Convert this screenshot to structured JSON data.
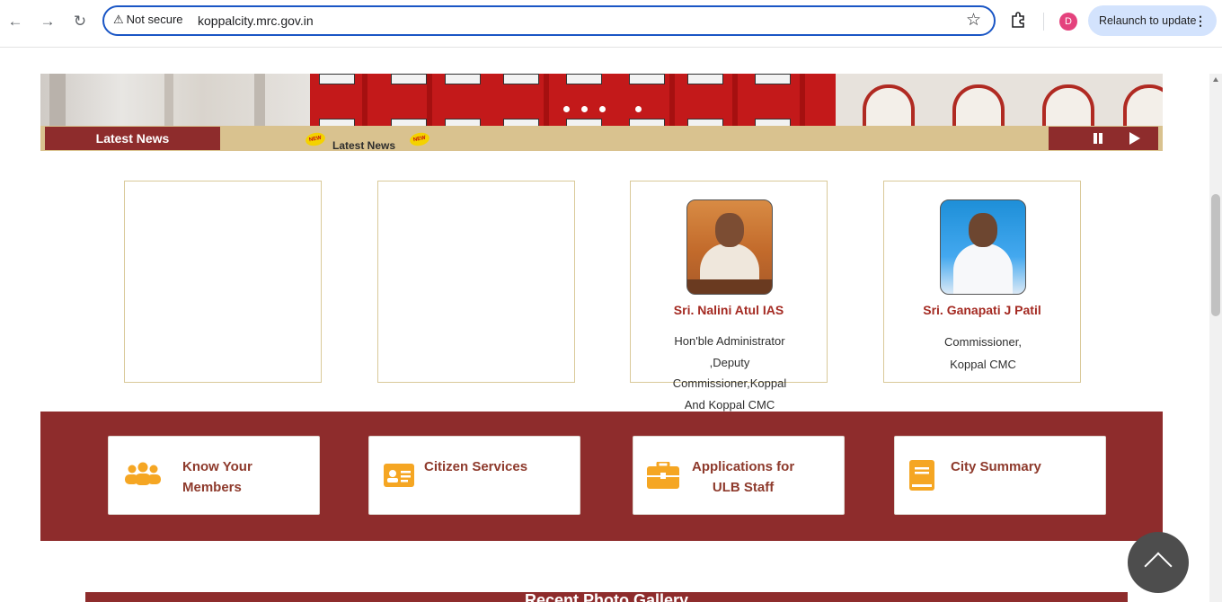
{
  "browser": {
    "security_label": "Not secure",
    "url": "koppalcity.mrc.gov.in",
    "avatar_letter": "D",
    "relaunch_label": "Relaunch to update"
  },
  "banner": {
    "slide_count": 4
  },
  "news": {
    "label": "Latest News",
    "ticker_text": "Latest News",
    "badge_text": "NEW"
  },
  "officials": [
    {
      "name": "Sri.  Nalini Atul  IAS",
      "role_lines": [
        "Hon'ble Administrator",
        ",Deputy",
        "Commissioner,Koppal",
        "And Koppal CMC"
      ]
    },
    {
      "name": "Sri. Ganapati J Patil",
      "role_lines": [
        "Commissioner,",
        "Koppal CMC"
      ]
    }
  ],
  "quick_links": [
    {
      "line1": "Know Your",
      "line2": "Members",
      "icon": "members-icon"
    },
    {
      "line1": "Citizen Services",
      "line2": "",
      "icon": "id-card-icon"
    },
    {
      "line1": "Applications for",
      "line2": "ULB Staff",
      "icon": "briefcase-icon"
    },
    {
      "line1": "City Summary",
      "line2": "",
      "icon": "book-icon"
    }
  ],
  "gallery": {
    "title": "Recent Photo Gallery"
  },
  "colors": {
    "maroon": "#8e2c2c",
    "gold": "#d9c28f",
    "accent_orange": "#f5a623",
    "name_red": "#a42a22"
  }
}
